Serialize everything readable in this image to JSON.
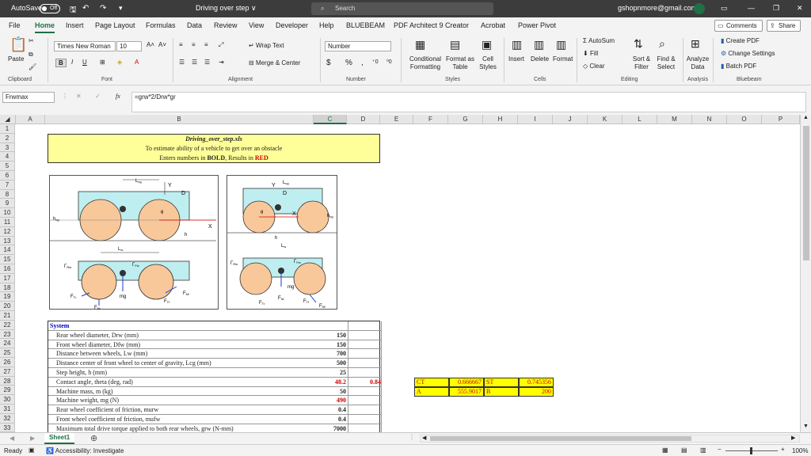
{
  "titlebar": {
    "autosave_label": "AutoSave",
    "autosave_state": "Off",
    "doc_title": "Driving over step ∨",
    "search_placeholder": "Search",
    "account": "gshopnmore@gmail.com"
  },
  "menu": {
    "tabs": [
      "File",
      "Home",
      "Insert",
      "Page Layout",
      "Formulas",
      "Data",
      "Review",
      "View",
      "Developer",
      "Help",
      "BLUEBEAM",
      "PDF Architect 9 Creator",
      "Acrobat",
      "Power Pivot"
    ],
    "comments": "Comments",
    "share": "Share"
  },
  "ribbon": {
    "paste": "Paste",
    "font_name": "Times New Roman",
    "font_size": "10",
    "wrap_text": "Wrap Text",
    "merge_center": "Merge & Center",
    "number_format": "Number",
    "cond_format": "Conditional Formatting",
    "format_table": "Format as Table",
    "cell_styles": "Cell Styles",
    "insert": "Insert",
    "delete": "Delete",
    "format": "Format",
    "autosum": "AutoSum",
    "fill": "Fill",
    "clear": "Clear",
    "sort_filter": "Sort & Filter",
    "find_select": "Find & Select",
    "analyze": "Analyze Data",
    "create_pdf": "Create PDF",
    "change_settings": "Change Settings",
    "batch_pdf": "Batch PDF",
    "groups": [
      "Clipboard",
      "Font",
      "Alignment",
      "Number",
      "Styles",
      "Cells",
      "Editing",
      "Analysis",
      "Bluebeam"
    ]
  },
  "formula": {
    "name_box": "Frwmax",
    "fx": "fx",
    "formula": "=grw*2/Drw*gr"
  },
  "columns": [
    "A",
    "B",
    "C",
    "D",
    "E",
    "F",
    "G",
    "H",
    "I",
    "J",
    "K",
    "L",
    "M",
    "N",
    "O",
    "P"
  ],
  "rows": [
    "1",
    "2",
    "3",
    "4",
    "5",
    "6",
    "7",
    "8",
    "9",
    "10",
    "11",
    "12",
    "13",
    "14",
    "15",
    "16",
    "17",
    "18",
    "19",
    "20",
    "21",
    "22",
    "23",
    "24",
    "25",
    "26",
    "27",
    "28",
    "29",
    "30",
    "31",
    "32",
    "33"
  ],
  "title_block": {
    "line1": "Driving_over_step.xls",
    "line2": "To estimate ability of a vehicle to get over an obstacle",
    "line3a": "Enters numbers in ",
    "bold": "BOLD",
    "line3b": ", Results in ",
    "red": "RED"
  },
  "table": {
    "header": "System",
    "rows": [
      {
        "label": "Rear wheel diameter, Drw (mm)",
        "value": "150",
        "value2": ""
      },
      {
        "label": "Front wheel diameter, Dfw (mm)",
        "value": "150",
        "value2": ""
      },
      {
        "label": "Distance between wheels, Lw (mm)",
        "value": "700",
        "value2": ""
      },
      {
        "label": "Distance center of front wheel to center of gravity, Lcg (mm)",
        "value": "500",
        "value2": ""
      },
      {
        "label": "Step height, h (mm)",
        "value": "25",
        "value2": ""
      },
      {
        "label": "Contact angle, theta (deg, rad)",
        "value": "48.2",
        "value2": "0.84"
      },
      {
        "label": "Machine mass, m (kg)",
        "value": "50",
        "value2": ""
      },
      {
        "label": "Machine weight, mg (N)",
        "value": "490",
        "value2": ""
      },
      {
        "label": "Rear wheel coefficient of friction, murw",
        "value": "0.4",
        "value2": ""
      },
      {
        "label": "Front wheel coefficient of friction, mufw",
        "value": "0.4",
        "value2": ""
      },
      {
        "label": "Maximum total drive torque applied to both rear wheels, grw (N-mm)",
        "value": "7000",
        "value2": ""
      }
    ],
    "red_rows": [
      5,
      7
    ]
  },
  "side_values": {
    "ct_label": "CT",
    "ct": "0.666667",
    "st_label": "ST",
    "st": "0.745356",
    "a_label": "A",
    "a": "555.9017",
    "b_label": "B",
    "b": "200"
  },
  "figure": {
    "lcg": "L",
    "lcg_sub": "cg",
    "y": "Y",
    "x": "X",
    "d": "D",
    "theta": "θ",
    "hcg": "h",
    "hcg_sub": "cg",
    "h": "h",
    "lw": "L",
    "lw_sub": "w",
    "grw": "Γ",
    "grw_sub": "Rw",
    "gfw": "Γ",
    "gfw_sub": "Fw",
    "ftr": "F",
    "ftr_sub": "Tr",
    "fnr": "F",
    "fnr_sub": "Nr",
    "mg": "mg",
    "ftf": "F",
    "ftf_sub": "Tf",
    "fnf": "F",
    "fnf_sub": "Nf"
  },
  "sheet": {
    "tab": "Sheet1"
  },
  "status": {
    "ready": "Ready",
    "accessibility": "Accessibility: Investigate",
    "zoom": "100%"
  },
  "colors": {
    "excel_green": "#1e7145",
    "title_fill": "#ffff99",
    "result_fill": "#ffff00",
    "result_text": "#d00000",
    "body_fill": "#bfeef0",
    "wheel_fill": "#f8c89a"
  }
}
